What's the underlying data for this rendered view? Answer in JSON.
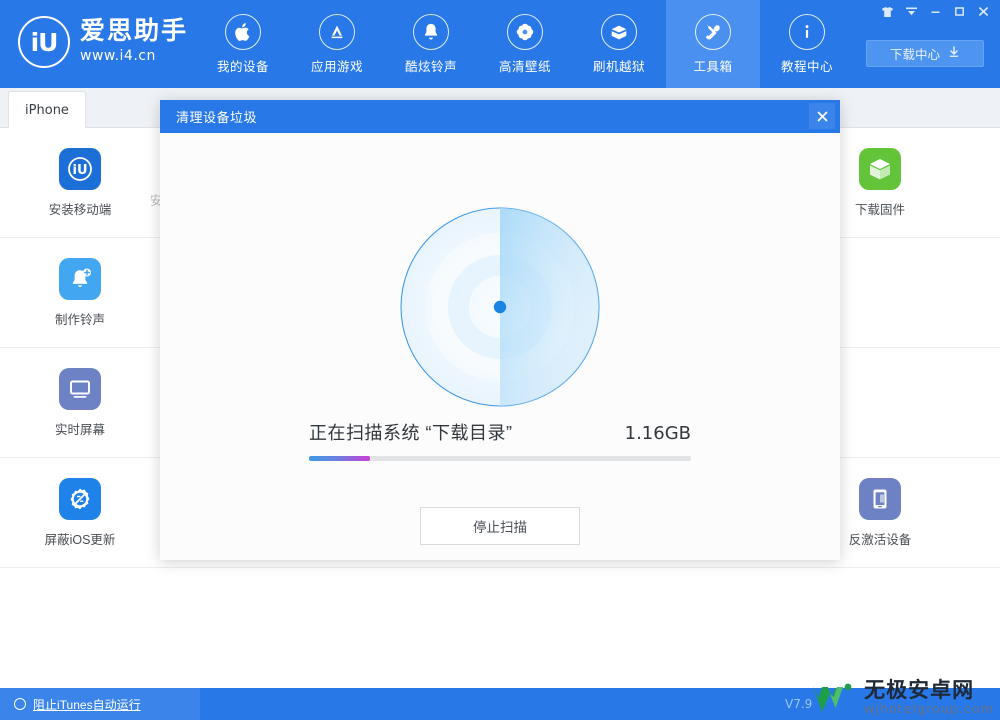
{
  "window": {
    "controls": [
      {
        "name": "skin-icon",
        "glyph": "skin"
      },
      {
        "name": "menu-icon",
        "glyph": "caret"
      },
      {
        "name": "minimize-icon",
        "glyph": "minimize"
      },
      {
        "name": "maximize-icon",
        "glyph": "maximize"
      },
      {
        "name": "close-icon",
        "glyph": "close"
      }
    ]
  },
  "brand": {
    "logo_text": "iU",
    "name": "爱思助手",
    "url": "www.i4.cn"
  },
  "nav": {
    "items": [
      {
        "label": "我的设备",
        "icon": "apple-icon",
        "active": false
      },
      {
        "label": "应用游戏",
        "icon": "appstore-icon",
        "active": false
      },
      {
        "label": "酷炫铃声",
        "icon": "bell-icon",
        "active": false
      },
      {
        "label": "高清壁纸",
        "icon": "flower-icon",
        "active": false
      },
      {
        "label": "刷机越狱",
        "icon": "box-open-icon",
        "active": false
      },
      {
        "label": "工具箱",
        "icon": "tools-icon",
        "active": true
      },
      {
        "label": "教程中心",
        "icon": "info-icon",
        "active": false
      }
    ],
    "download_center": "下载中心"
  },
  "tabs": {
    "items": [
      {
        "label": "iPhone",
        "active": true
      }
    ]
  },
  "toolbox": {
    "rows": [
      [
        {
          "label": "安装移动端",
          "icon": "iu-app-icon",
          "color": "#1c6fd6"
        },
        {
          "label": "",
          "icon": "",
          "color": ""
        },
        {
          "label": "",
          "icon": "",
          "color": ""
        },
        {
          "label": "",
          "icon": "",
          "color": ""
        },
        {
          "label": "",
          "icon": "",
          "color": ""
        },
        {
          "label": "下载固件",
          "icon": "green-box-icon",
          "color": "#63c43a"
        }
      ],
      [
        {
          "label": "制作铃声",
          "icon": "bell-plus-icon",
          "color": "#43a6f0"
        },
        {
          "label": "",
          "icon": "",
          "color": ""
        },
        {
          "label": "",
          "icon": "",
          "color": ""
        },
        {
          "label": "",
          "icon": "",
          "color": ""
        },
        {
          "label": "",
          "icon": "",
          "color": ""
        },
        {
          "label": "",
          "icon": "",
          "color": ""
        }
      ],
      [
        {
          "label": "实时屏幕",
          "icon": "monitor-icon",
          "color": "#6d82c4"
        },
        {
          "label": "",
          "icon": "",
          "color": ""
        },
        {
          "label": "",
          "icon": "",
          "color": ""
        },
        {
          "label": "",
          "icon": "",
          "color": ""
        },
        {
          "label": "",
          "icon": "",
          "color": ""
        },
        {
          "label": "",
          "icon": "",
          "color": ""
        }
      ],
      [
        {
          "label": "屏蔽iOS更新",
          "icon": "gear-block-icon",
          "color": "#1f82e8"
        },
        {
          "label": "",
          "icon": "",
          "color": ""
        },
        {
          "label": "",
          "icon": "",
          "color": ""
        },
        {
          "label": "",
          "icon": "",
          "color": ""
        },
        {
          "label": "",
          "icon": "",
          "color": ""
        },
        {
          "label": "反激活设备",
          "icon": "device-deactivate-icon",
          "color": "#6d82c4"
        }
      ]
    ]
  },
  "dialog": {
    "title": "清理设备垃圾",
    "close_label": "✕",
    "scan_label": "正在扫描系统 “下载目录”",
    "scan_size": "1.16GB",
    "progress_percent": 16,
    "stop_button": "停止扫描",
    "radar": {
      "sweep_color": "#9fd4f7",
      "ring_color": "#3d9ae8",
      "center_dot_color": "#1a84e2"
    }
  },
  "statusbar": {
    "itunes_toggle": "阻止iTunes自动运行",
    "version": "V7.9"
  },
  "watermark": {
    "cn": "无极安卓网",
    "en": "wjhotelgroup.com"
  },
  "colors": {
    "brand_blue": "#2878e8",
    "nav_active": "#4a90f0",
    "progress_start": "#3d9ae8",
    "progress_end": "#c940d8"
  }
}
